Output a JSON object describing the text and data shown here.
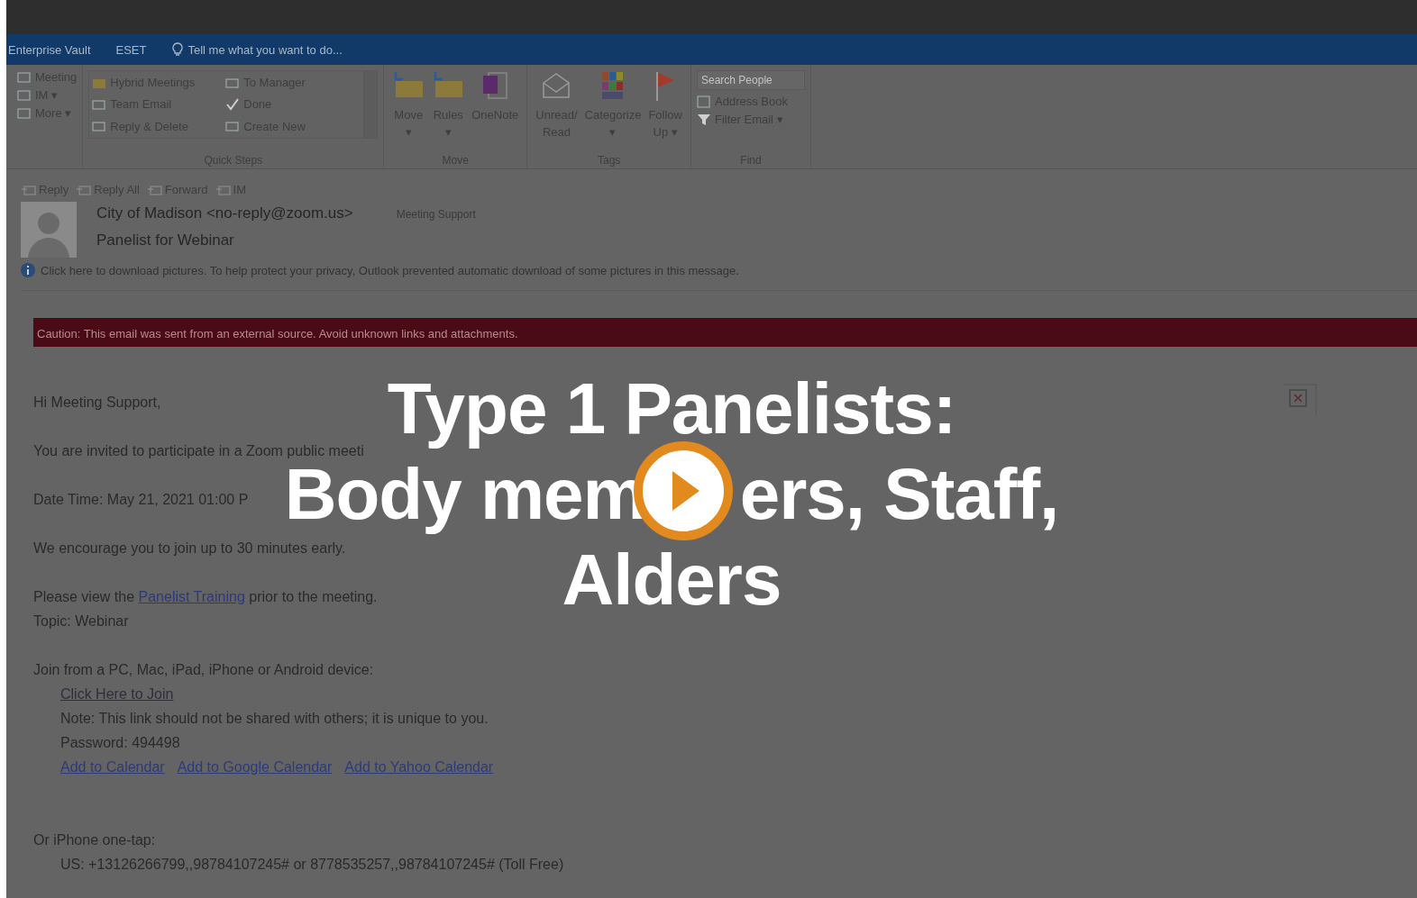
{
  "ribbon_tabs": [
    {
      "label": "Enterprise Vault",
      "kind": "tab"
    },
    {
      "label": "ESET",
      "kind": "tab"
    },
    {
      "label": "Tell me what you want to do...",
      "kind": "search"
    }
  ],
  "ribbon": {
    "groups": [
      {
        "items": [
          {
            "label": "Meeting"
          },
          {
            "label": "IM ▾"
          },
          {
            "label": "More ▾"
          }
        ]
      },
      {
        "caption": "Quick Steps",
        "quick_steps": [
          {
            "label": "Hybrid Meetings"
          },
          {
            "label": "To Manager"
          },
          {
            "label": "Team Email"
          },
          {
            "label": "Done"
          },
          {
            "label": "Reply & Delete"
          },
          {
            "label": "Create New"
          }
        ]
      },
      {
        "caption": "Move",
        "big": [
          {
            "label": "Move",
            "sub": "▾"
          },
          {
            "label": "Rules",
            "sub": "▾"
          },
          {
            "label": "OneNote"
          }
        ]
      },
      {
        "caption": "Tags",
        "big": [
          {
            "label": "Unread/",
            "sub": "Read"
          },
          {
            "label": "Categorize",
            "sub": "▾"
          },
          {
            "label": "Follow",
            "sub": "Up ▾"
          }
        ]
      },
      {
        "caption": "Find",
        "search_placeholder": "Search People",
        "items": [
          {
            "label": "Address Book"
          },
          {
            "label": "Filter Email ▾"
          }
        ]
      }
    ]
  },
  "actions": [
    {
      "label": "Reply"
    },
    {
      "label": "Reply All"
    },
    {
      "label": "Forward"
    },
    {
      "label": "IM"
    }
  ],
  "message": {
    "from": "City of Madison <no-reply@zoom.us>",
    "to": "Meeting Support",
    "subject": "Panelist for Webinar",
    "info": "Click here to download pictures. To help protect your privacy, Outlook prevented automatic download of some pictures in this message.",
    "caution": "Caution: This email was sent from an external source. Avoid unknown links and attachments.",
    "body": [
      {
        "kind": "line",
        "parts": [
          {
            "text": "Hi Meeting Support,",
            "link": false
          }
        ]
      },
      {
        "kind": "para",
        "parts": [
          {
            "text": "You are invited to participate in a Zoom public meeti",
            "link": false
          }
        ]
      },
      {
        "kind": "para",
        "parts": [
          {
            "text": "Date Time: May 21, 2021 01:00 P",
            "link": false
          }
        ]
      },
      {
        "kind": "para",
        "parts": [
          {
            "text": "We encourage you to join up to 30 minutes early.",
            "link": false
          }
        ]
      },
      {
        "kind": "para",
        "parts": [
          {
            "text": "Please view the ",
            "link": false
          },
          {
            "text": "Panelist Training",
            "link": true
          },
          {
            "text": " prior to the meeting.",
            "link": false
          }
        ]
      },
      {
        "kind": "line",
        "parts": [
          {
            "text": "Topic: Webinar",
            "link": false
          }
        ]
      },
      {
        "kind": "para",
        "parts": [
          {
            "text": "Join from a PC, Mac, iPad, iPhone or Android device:",
            "link": false
          }
        ]
      },
      {
        "kind": "sub",
        "parts": [
          {
            "text": "Click Here to Join",
            "link": true
          }
        ]
      },
      {
        "kind": "sub",
        "parts": [
          {
            "text": "Note: This link should not be shared with others; it is unique to you.",
            "link": false
          }
        ]
      },
      {
        "kind": "sub",
        "parts": [
          {
            "text": "Password: 494498",
            "link": false
          }
        ]
      },
      {
        "kind": "links",
        "parts": [
          {
            "text": "Add to Calendar",
            "link": true
          },
          {
            "text": "Add to Google Calendar",
            "link": true
          },
          {
            "text": "Add to Yahoo Calendar",
            "link": true
          }
        ]
      },
      {
        "kind": "section",
        "parts": [
          {
            "text": "Or iPhone one-tap:",
            "link": false
          }
        ]
      },
      {
        "kind": "sub",
        "parts": [
          {
            "text": "US: +13126266799,,98784107245# or 8778535257,,98784107245# (Toll Free)",
            "link": false
          }
        ]
      }
    ]
  },
  "overlay": {
    "title_lines": [
      [
        "Type 1 Panelists:"
      ],
      [
        "Body mem",
        "ers, Staff,"
      ],
      [
        "Alders"
      ]
    ]
  }
}
